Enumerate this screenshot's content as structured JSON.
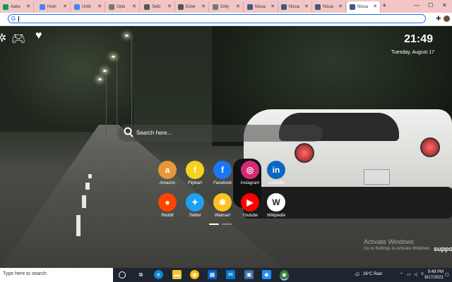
{
  "browser": {
    "tabs": [
      {
        "label": "Aaku",
        "favicon": "sheets-icon",
        "color": "#0f9d58"
      },
      {
        "label": "Hom",
        "favicon": "google-icon",
        "color": "#4285f4"
      },
      {
        "label": "Untit",
        "favicon": "google-icon",
        "color": "#4285f4"
      },
      {
        "label": "Uplo",
        "favicon": "globe-icon",
        "color": "#777777"
      },
      {
        "label": "Setti",
        "favicon": "gear-icon",
        "color": "#555555"
      },
      {
        "label": "Exter",
        "favicon": "puzzle-icon",
        "color": "#555555"
      },
      {
        "label": "Only",
        "favicon": "globe-icon",
        "color": "#777777"
      },
      {
        "label": "Nissa",
        "favicon": "nissan-icon",
        "color": "#3d5a80"
      },
      {
        "label": "Nissa",
        "favicon": "nissan-icon",
        "color": "#3d5a80"
      },
      {
        "label": "Nissa",
        "favicon": "nissan-icon",
        "color": "#3d5a80"
      },
      {
        "label": "Nissa",
        "favicon": "nissan-icon",
        "color": "#3d5a80",
        "active": true
      }
    ],
    "new_tab": "+",
    "address": ""
  },
  "newtab": {
    "time": "21:49",
    "date": "Tuesday, August 17",
    "search_placeholder": "Search here...",
    "shortcuts": [
      {
        "label": "Amazon",
        "icon": "amazon-icon",
        "glyph": "a",
        "color": "#e8963a"
      },
      {
        "label": "Flipkart",
        "icon": "flipkart-icon",
        "glyph": "f",
        "color": "#f7d21e"
      },
      {
        "label": "Facebook",
        "icon": "facebook-icon",
        "glyph": "f",
        "color": "#1877f2"
      },
      {
        "label": "Instagram",
        "icon": "instagram-icon",
        "glyph": "◎",
        "color": "#d62976"
      },
      {
        "label": "Linkedin",
        "icon": "linkedin-icon",
        "glyph": "in",
        "color": "#0a66c2"
      },
      {
        "label": "Reddit",
        "icon": "reddit-icon",
        "glyph": "●",
        "color": "#ff4500"
      },
      {
        "label": "Twitter",
        "icon": "twitter-icon",
        "glyph": "✦",
        "color": "#1da1f2"
      },
      {
        "label": "Walmart",
        "icon": "walmart-icon",
        "glyph": "✱",
        "color": "#ffc220"
      },
      {
        "label": "Youtube",
        "icon": "youtube-icon",
        "glyph": "▶",
        "color": "#ff0000"
      },
      {
        "label": "Wikipedia",
        "icon": "wikipedia-icon",
        "glyph": "W",
        "color": "#ffffff"
      }
    ]
  },
  "watermark": {
    "line1": "Activate Windows",
    "line2": "Go to Settings to activate Windows.",
    "extra": "suppo"
  },
  "taskbar": {
    "search_placeholder": "Type here to search",
    "weather": "26°C  Rain",
    "time": "9:49 PM",
    "date": "8/17/2021"
  }
}
